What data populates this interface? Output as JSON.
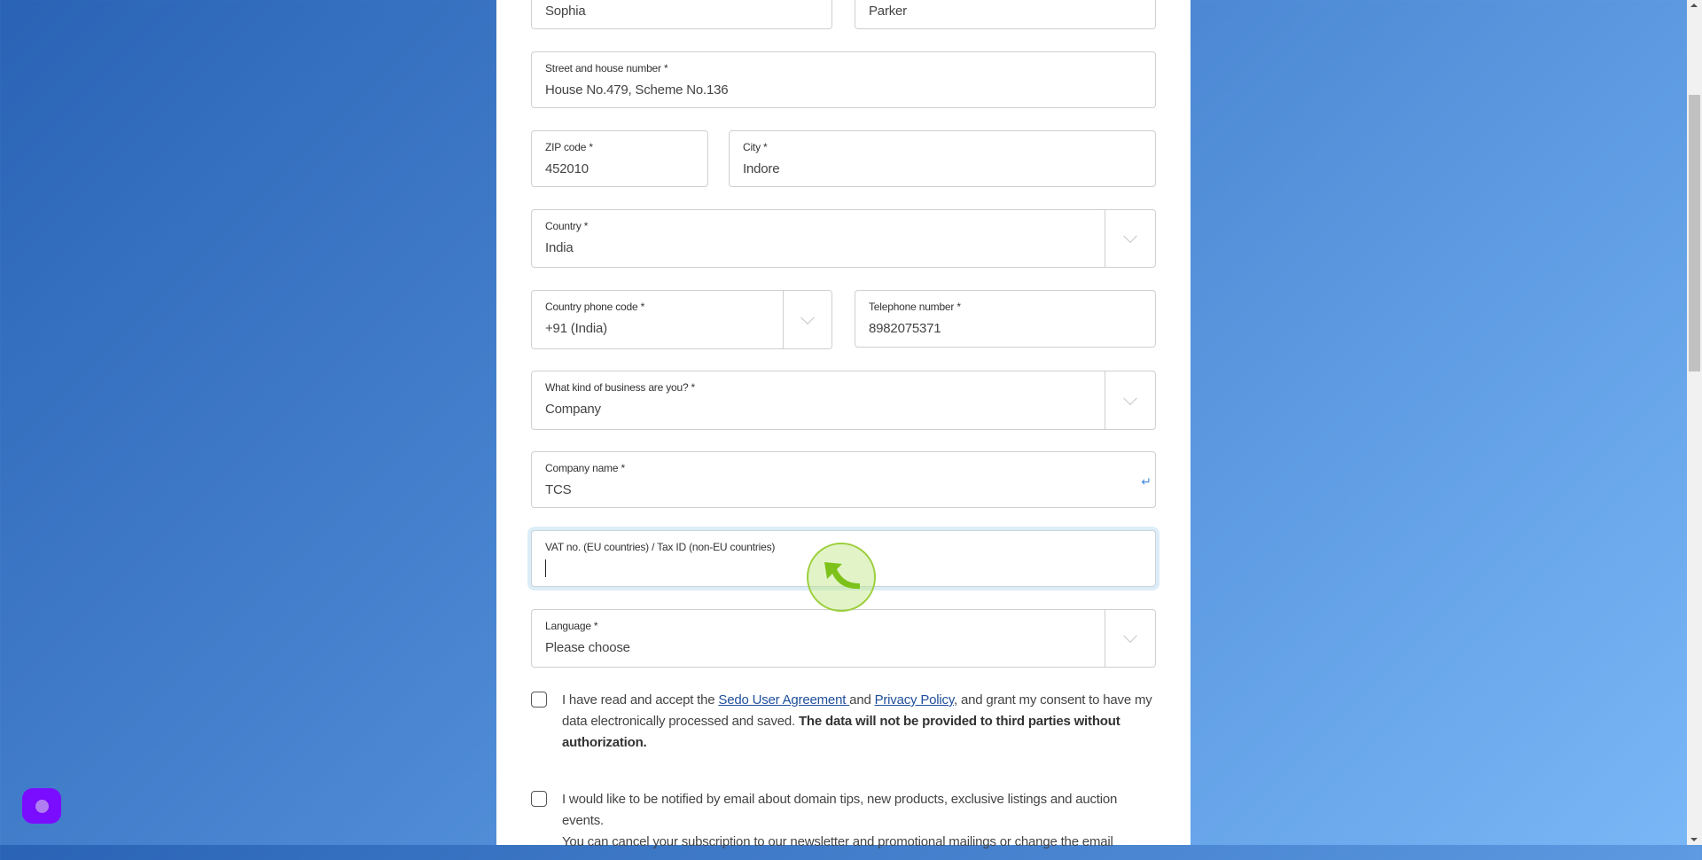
{
  "form": {
    "first_name": {
      "value": "Sophia"
    },
    "last_name": {
      "value": "Parker"
    },
    "street": {
      "label": "Street and house number *",
      "value": "House No.479, Scheme No.136"
    },
    "zip": {
      "label": "ZIP code *",
      "value": "452010"
    },
    "city": {
      "label": "City *",
      "value": "Indore"
    },
    "country": {
      "label": "Country *",
      "value": "India"
    },
    "phone_code": {
      "label": "Country phone code *",
      "value": "+91 (India)"
    },
    "telephone": {
      "label": "Telephone number *",
      "value": "8982075371"
    },
    "business_type": {
      "label": "What kind of business are you? *",
      "value": "Company"
    },
    "company_name": {
      "label": "Company name *",
      "value": "TCS",
      "enter_icon": "↵"
    },
    "vat": {
      "label": "VAT no. (EU countries) / Tax ID (non-EU countries)",
      "value": ""
    },
    "language": {
      "label": "Language *",
      "value": "Please choose"
    }
  },
  "consent": {
    "agreement": {
      "text_before": "I have read and accept the ",
      "link1": "Sedo User Agreement ",
      "text_mid": "and ",
      "link2": "Privacy Policy",
      "text_after": ", and grant my consent to have my data electronically processed and saved. ",
      "bold": "The data will not be provided to third parties without authorization.",
      "checked": false
    },
    "newsletter": {
      "text": "I would like to be notified by email about domain tips, new products, exclusive listings and auction events.",
      "text2": "You can cancel your subscription to our newsletter and promotional mailings or change the email",
      "checked": false
    }
  },
  "colors": {
    "link": "#1f4f9b",
    "focus_ring": "#dcedf7",
    "fab": "#7a0cff",
    "cursor_highlight": "#9ccf3c"
  }
}
